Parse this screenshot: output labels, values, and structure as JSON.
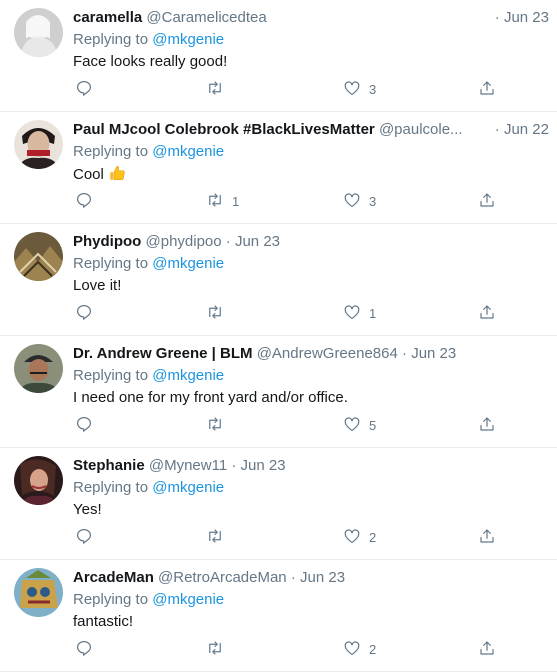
{
  "reply_prefix": "Replying to",
  "colors": {
    "accent": "#1b95e0",
    "muted": "#657786",
    "text": "#14171a",
    "divider": "#e6ecf0"
  },
  "icons": {
    "reply": "reply-bubble-icon",
    "retweet": "retweet-icon",
    "like": "heart-icon",
    "share": "share-upload-icon"
  },
  "tweets": [
    {
      "name": "caramella",
      "handle": "@Caramelicedtea",
      "dot": "·",
      "time": "Jun 23",
      "mention": "@mkgenie",
      "text": "Face looks really good!",
      "replies": "",
      "retweets": "",
      "likes": "3"
    },
    {
      "name": "Paul MJcool Colebrook #BlackLivesMatter",
      "handle": "@paulcole...",
      "dot": "·",
      "time": "Jun 22",
      "mention": "@mkgenie",
      "text": "Cool",
      "emoji": "thumbs-up-emoji",
      "replies": "",
      "retweets": "1",
      "likes": "3"
    },
    {
      "name": "Phydipoo",
      "handle": "@phydipoo",
      "dot": "·",
      "time": "Jun 23",
      "mention": "@mkgenie",
      "text": "Love it!",
      "replies": "",
      "retweets": "",
      "likes": "1"
    },
    {
      "name": "Dr. Andrew Greene | BLM",
      "handle": "@AndrewGreene864",
      "dot": "·",
      "time": "Jun 23",
      "mention": "@mkgenie",
      "text": "I need one for my front yard and/or office.",
      "replies": "",
      "retweets": "",
      "likes": "5"
    },
    {
      "name": "Stephanie",
      "handle": "@Mynew11",
      "dot": "·",
      "time": "Jun 23",
      "mention": "@mkgenie",
      "text": "Yes!",
      "replies": "",
      "retweets": "",
      "likes": "2"
    },
    {
      "name": "ArcadeMan",
      "handle": "@RetroArcadeMan",
      "dot": "·",
      "time": "Jun 23",
      "mention": "@mkgenie",
      "text": "fantastic!",
      "replies": "",
      "retweets": "",
      "likes": "2"
    }
  ]
}
